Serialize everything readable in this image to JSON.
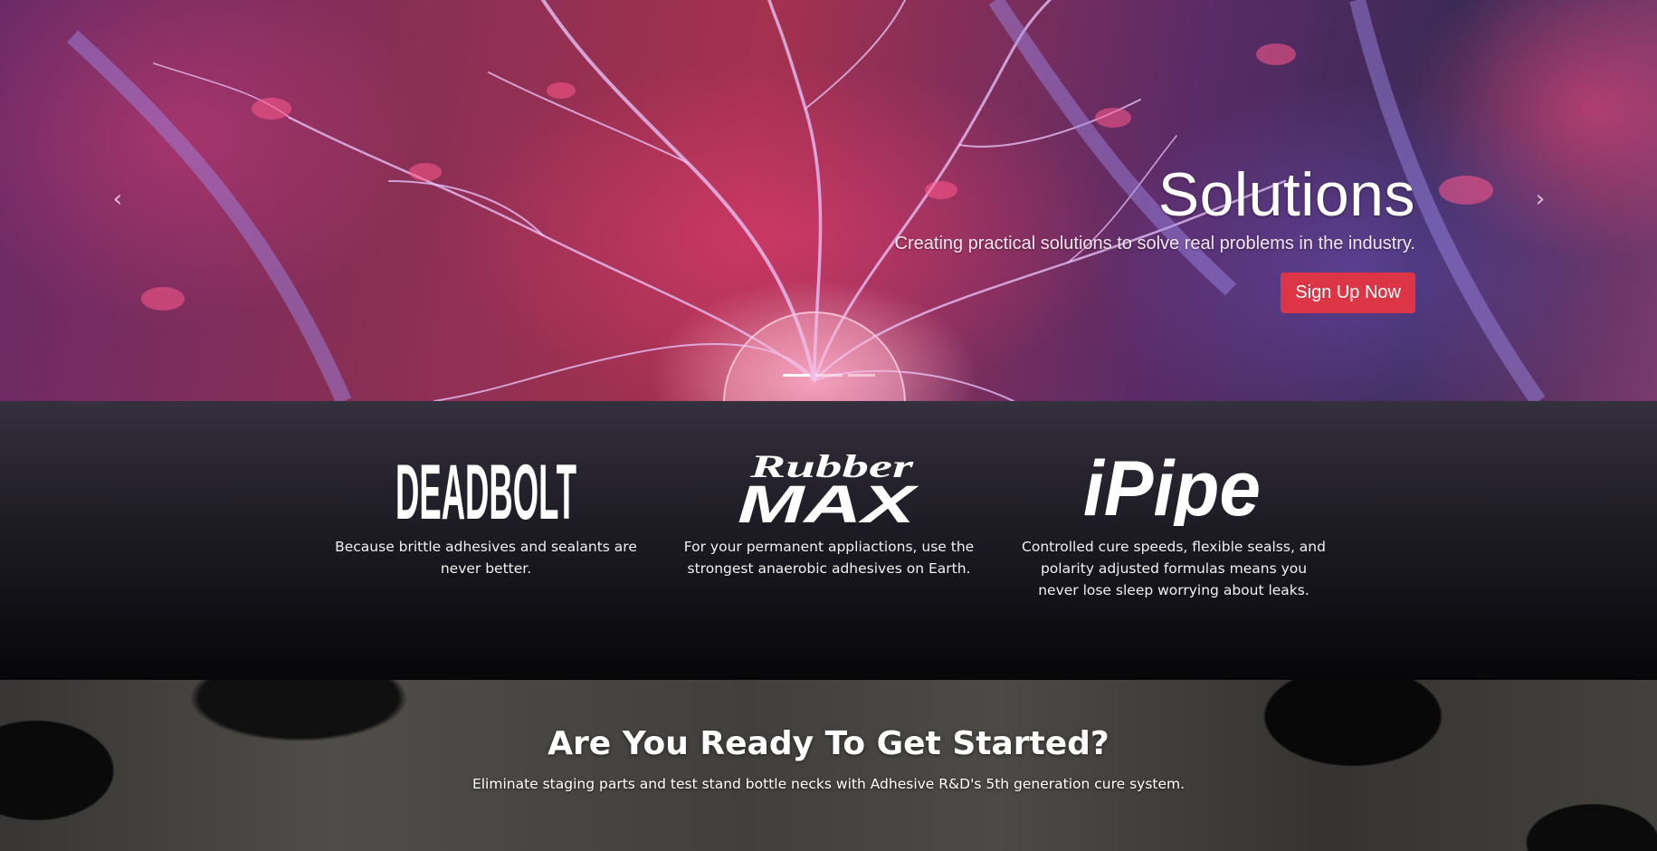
{
  "hero": {
    "slides_count": 3,
    "active_slide": 1,
    "title": "Solutions",
    "subtitle": "Creating practical solutions to solve real problems in the industry.",
    "button_label": "Sign Up Now",
    "prev_icon": "chevron-left-icon",
    "next_icon": "chevron-right-icon",
    "prev_glyph": "‹",
    "next_glyph": "›",
    "button_color": "#dc3545"
  },
  "products": [
    {
      "logo_text": "DEADBOLT",
      "description": "Because brittle adhesives and sealants are never better."
    },
    {
      "logo_text_top": "Rubber",
      "logo_text_bottom": "MAX",
      "description": "For your permanent appliactions, use the strongest anaerobic adhesives on Earth."
    },
    {
      "logo_text": "iPipe",
      "description": "Controlled cure speeds, flexible sealss, and polarity adjusted formulas means you never lose sleep worrying about leaks."
    }
  ],
  "cta": {
    "title": "Are You Ready To Get Started?",
    "subtitle": "Eliminate staging parts and test stand bottle necks with Adhesive R&D's 5th generation cure system."
  }
}
